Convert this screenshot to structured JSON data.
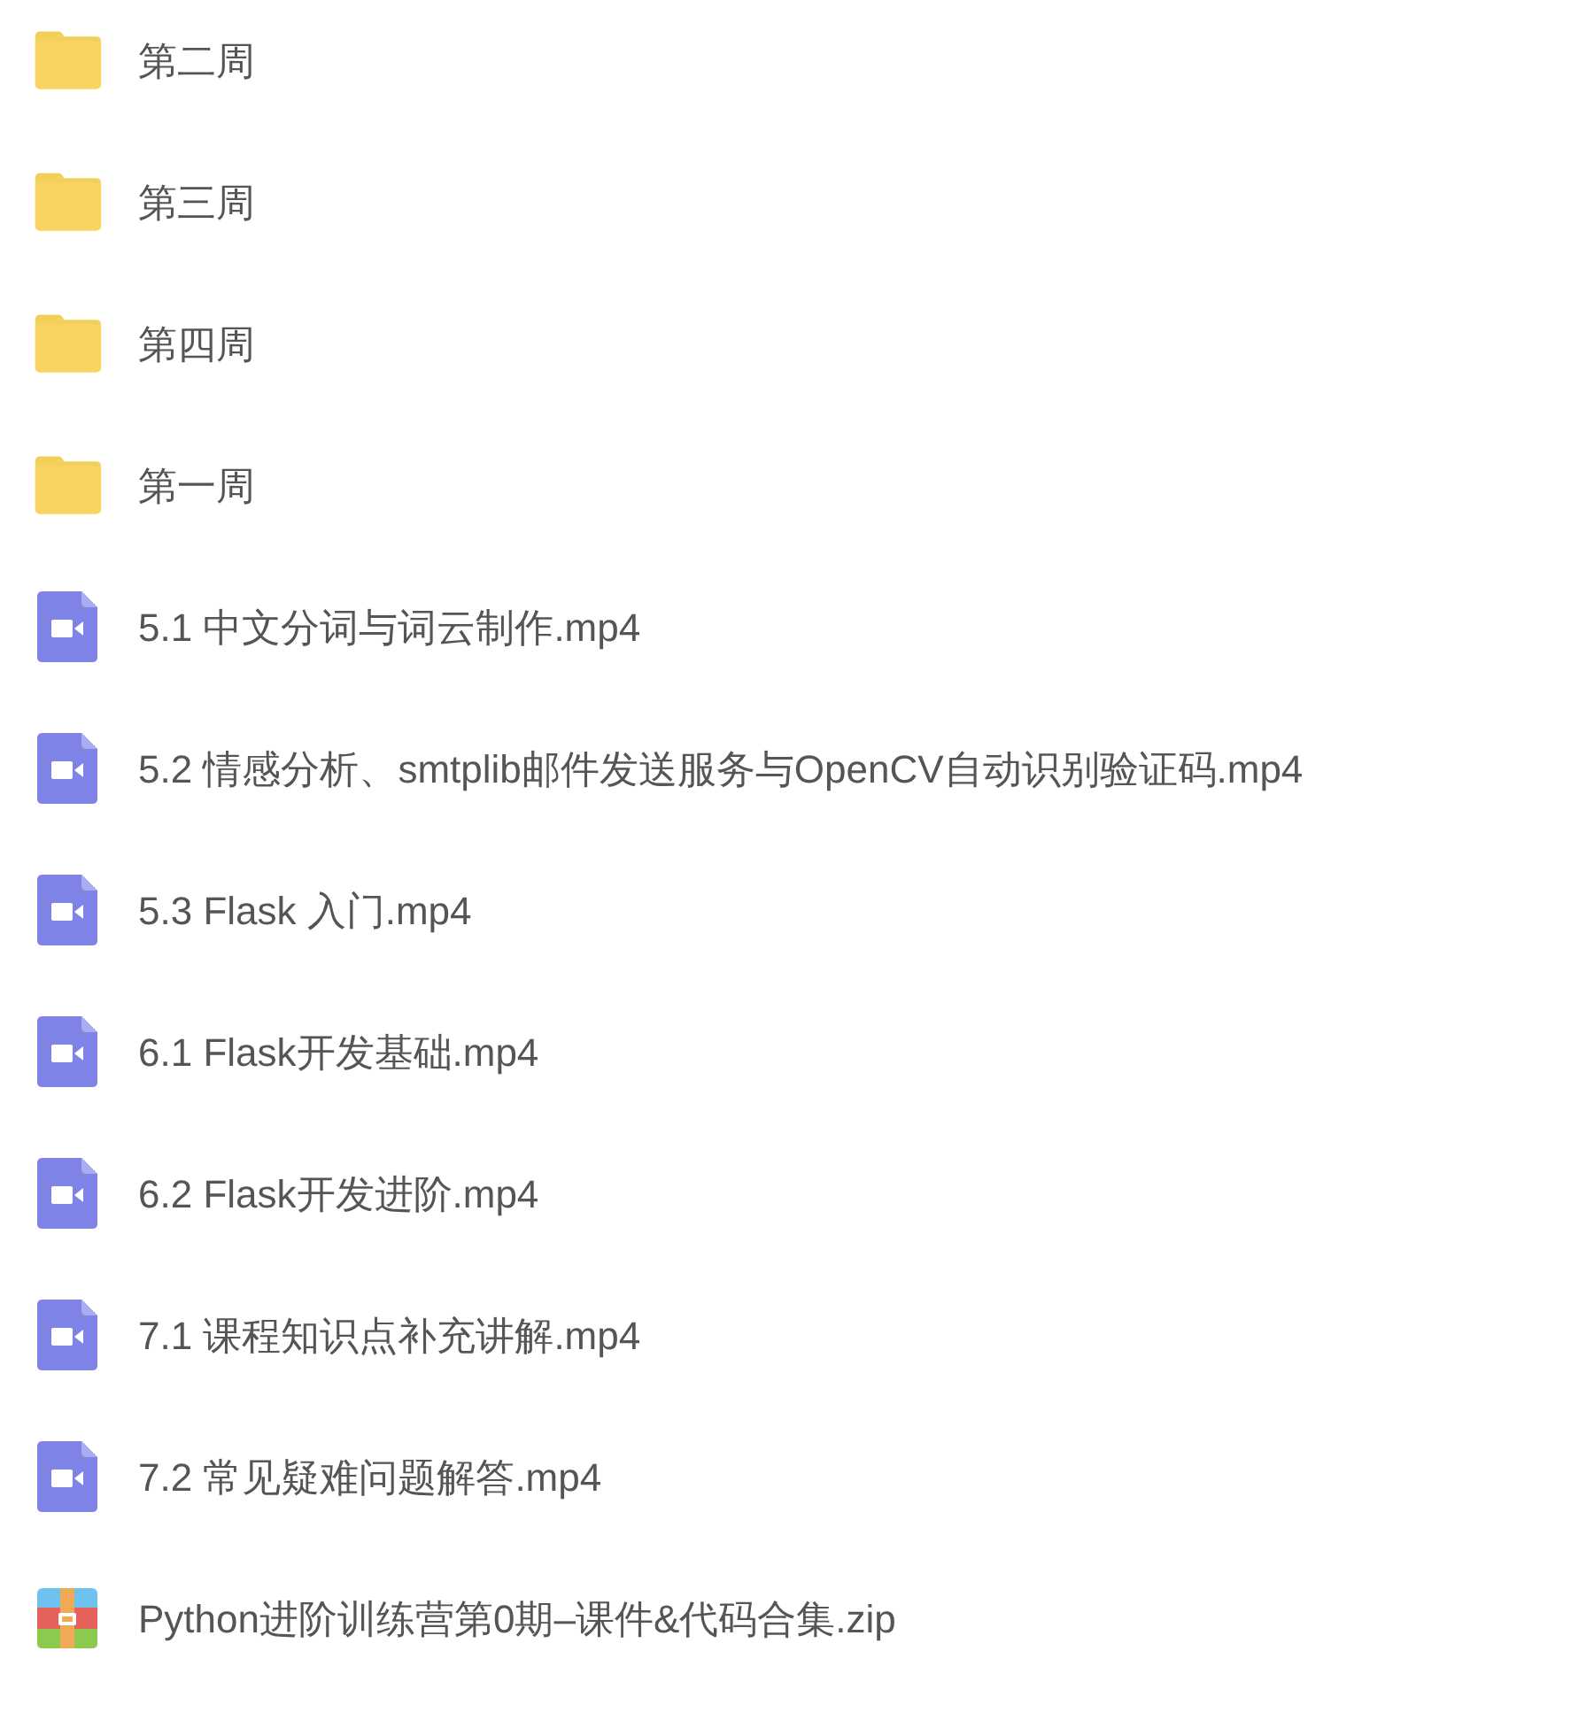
{
  "files": [
    {
      "kind": "folder",
      "name": "第二周"
    },
    {
      "kind": "folder",
      "name": "第三周"
    },
    {
      "kind": "folder",
      "name": "第四周"
    },
    {
      "kind": "folder",
      "name": "第一周"
    },
    {
      "kind": "video",
      "name": "5.1 中文分词与词云制作.mp4"
    },
    {
      "kind": "video",
      "name": "5.2 情感分析、smtplib邮件发送服务与OpenCV自动识别验证码.mp4"
    },
    {
      "kind": "video",
      "name": "5.3 Flask 入门.mp4"
    },
    {
      "kind": "video",
      "name": "6.1 Flask开发基础.mp4"
    },
    {
      "kind": "video",
      "name": "6.2 Flask开发进阶.mp4"
    },
    {
      "kind": "video",
      "name": "7.1 课程知识点补充讲解.mp4"
    },
    {
      "kind": "video",
      "name": "7.2 常见疑难问题解答.mp4"
    },
    {
      "kind": "archive",
      "name": "Python进阶训练营第0期–课件&代码合集.zip"
    }
  ]
}
